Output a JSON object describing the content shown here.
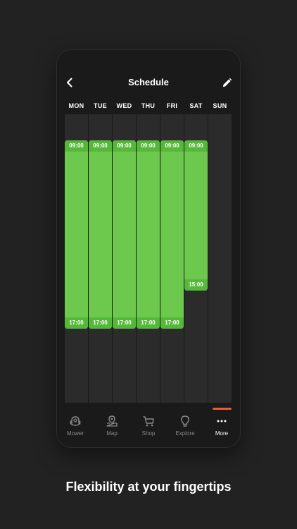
{
  "header": {
    "title": "Schedule",
    "back_icon": "chevron-left-icon",
    "edit_icon": "pencil-icon"
  },
  "days": [
    {
      "label": "MON",
      "start": "09:00",
      "end": "17:00"
    },
    {
      "label": "TUE",
      "start": "09:00",
      "end": "17:00"
    },
    {
      "label": "WED",
      "start": "09:00",
      "end": "17:00"
    },
    {
      "label": "THU",
      "start": "09:00",
      "end": "17:00"
    },
    {
      "label": "FRI",
      "start": "09:00",
      "end": "17:00"
    },
    {
      "label": "SAT",
      "start": "09:00",
      "end": "15:00"
    },
    {
      "label": "SUN",
      "start": null,
      "end": null
    }
  ],
  "nav": {
    "items": [
      {
        "label": "Mower",
        "icon": "mower-icon"
      },
      {
        "label": "Map",
        "icon": "map-icon"
      },
      {
        "label": "Shop",
        "icon": "cart-icon"
      },
      {
        "label": "Explore",
        "icon": "lightbulb-icon"
      },
      {
        "label": "More",
        "icon": "more-dots-icon"
      }
    ],
    "active": "More"
  },
  "tagline": "Flexibility at your fingertips",
  "colors": {
    "background": "#222222",
    "phone": "#1a1a1a",
    "column": "#2b2b2b",
    "schedule_block": "#6cc94e",
    "time_label_bg": "#56b83a",
    "accent": "#e85e2c"
  }
}
